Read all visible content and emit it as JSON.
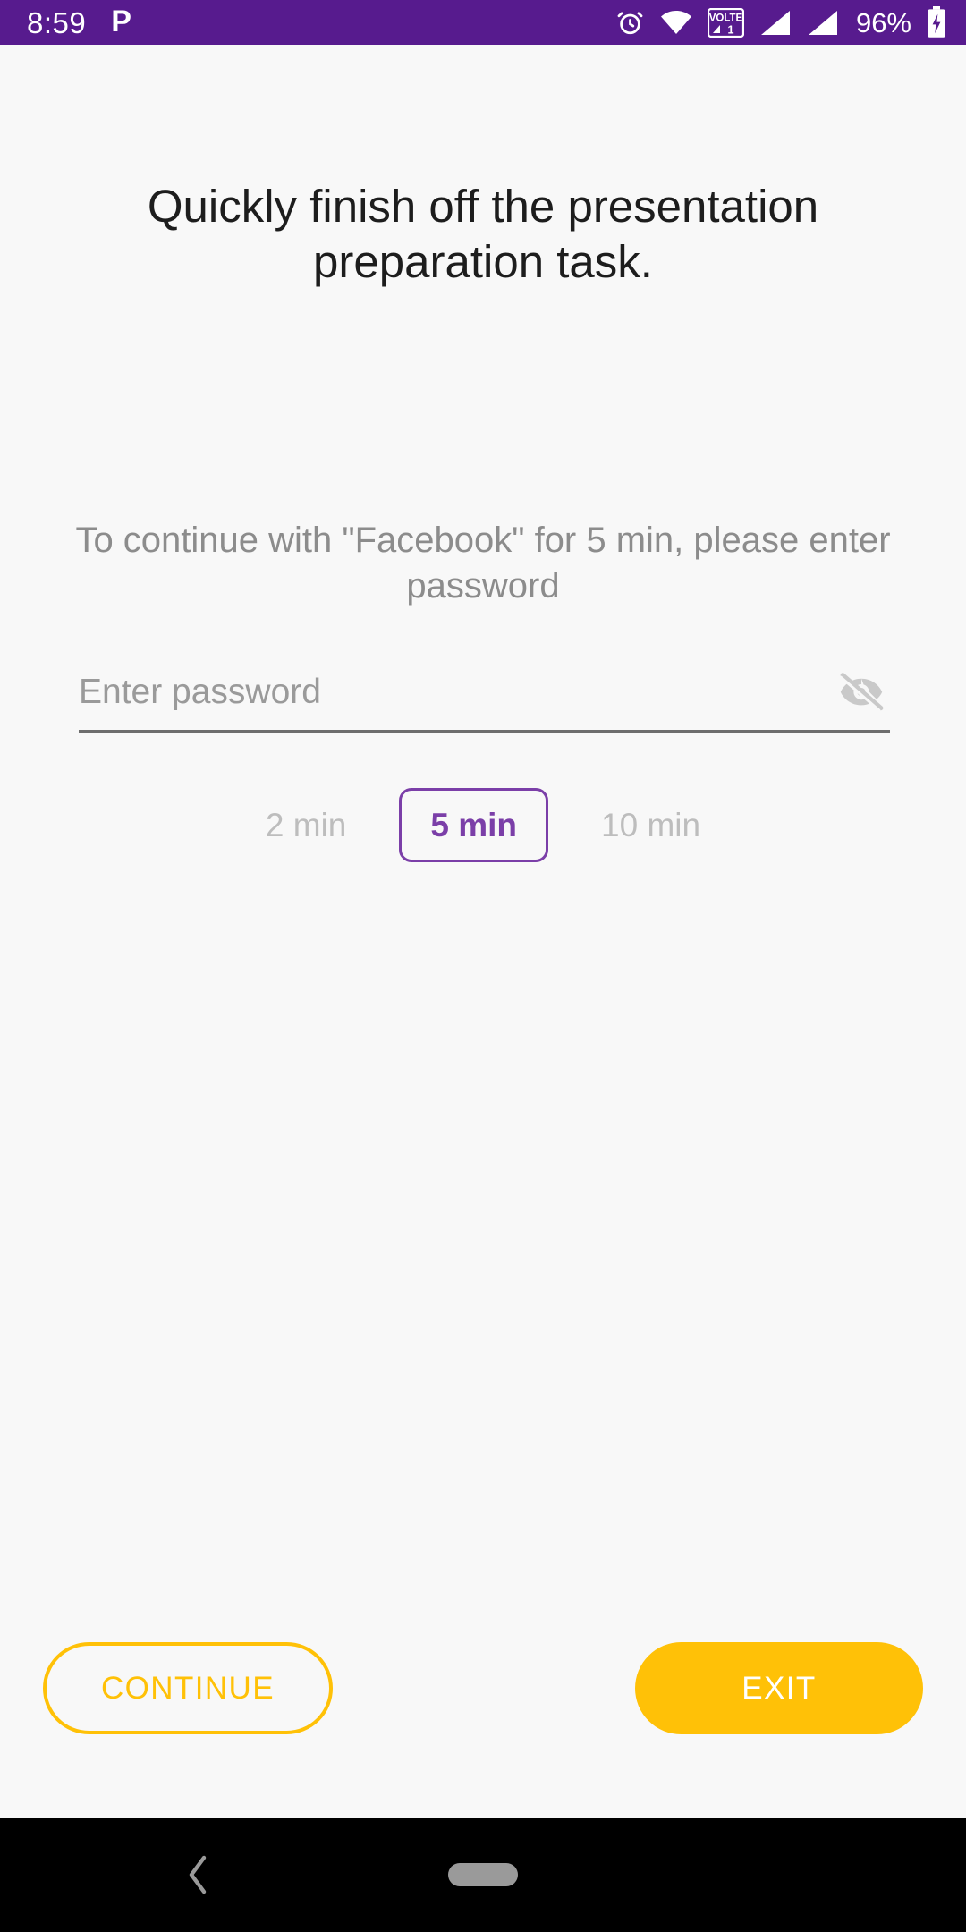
{
  "status_bar": {
    "time": "8:59",
    "notification_icon": "P",
    "icons": [
      "alarm-icon",
      "wifi-icon",
      "volte-icon",
      "signal-sim1-icon",
      "signal-sim2-icon"
    ],
    "volte_label": "VOLTE",
    "volte_sim": "1",
    "battery_percent": "96%",
    "battery_state": "charging",
    "background_color": "#571B8E",
    "foreground_color": "#FFFFFF"
  },
  "screen": {
    "background_color": "#F8F8F8",
    "headline": "Quickly finish off the presentation preparation task.",
    "prompt": "To continue with \"Facebook\" for 5 min, please enter password",
    "app_name": "Facebook",
    "selected_duration": "5 min"
  },
  "password_field": {
    "name": "password",
    "value": "",
    "placeholder": "Enter password",
    "masked": true,
    "toggle_icon": "eye-off-icon",
    "toggle_icon_color": "#C9C9C9",
    "underline_color": "#6E6E6E"
  },
  "duration_chips": {
    "accent_color": "#7B3FA8",
    "inactive_color": "#BDBDBD",
    "options": [
      {
        "label": "2 min",
        "selected": false
      },
      {
        "label": "5 min",
        "selected": true
      },
      {
        "label": "10 min",
        "selected": false
      }
    ]
  },
  "actions": {
    "accent_color": "#FFC107",
    "continue_label": "CONTINUE",
    "exit_label": "EXIT"
  },
  "navigation_bar": {
    "background_color": "#000000",
    "back_label": "Back",
    "home_label": "Home",
    "back_icon": "chevron-left-icon",
    "home_icon": "home-pill-icon"
  }
}
